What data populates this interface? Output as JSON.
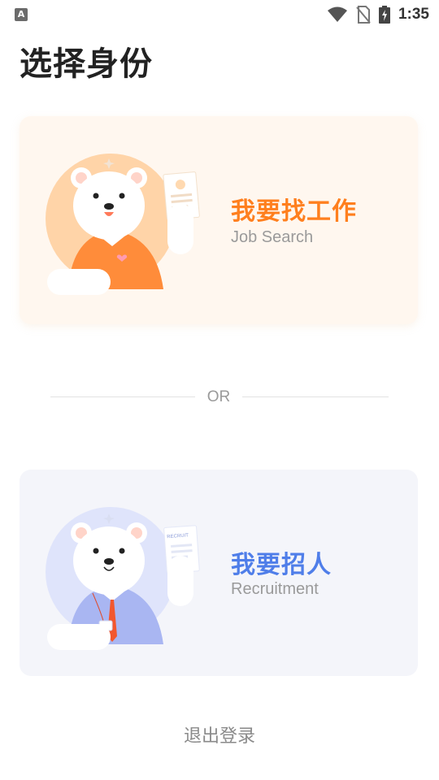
{
  "status_bar": {
    "time": "1:35",
    "app_icon_letter": "A",
    "icons": [
      "app-notification-icon",
      "wifi-icon",
      "no-sim-icon",
      "battery-charging-icon"
    ]
  },
  "page": {
    "title": "选择身份"
  },
  "job_card": {
    "title": "我要找工作",
    "subtitle": "Job Search",
    "accent_color": "#ff7f1e",
    "background_color": "#fff7ef"
  },
  "separator": {
    "label": "OR"
  },
  "recruit_card": {
    "title": "我要招人",
    "subtitle": "Recruitment",
    "document_label": "RECRUIT",
    "accent_color": "#4f7ee9",
    "background_color": "#f4f5fa"
  },
  "footer": {
    "logout_label": "退出登录"
  }
}
